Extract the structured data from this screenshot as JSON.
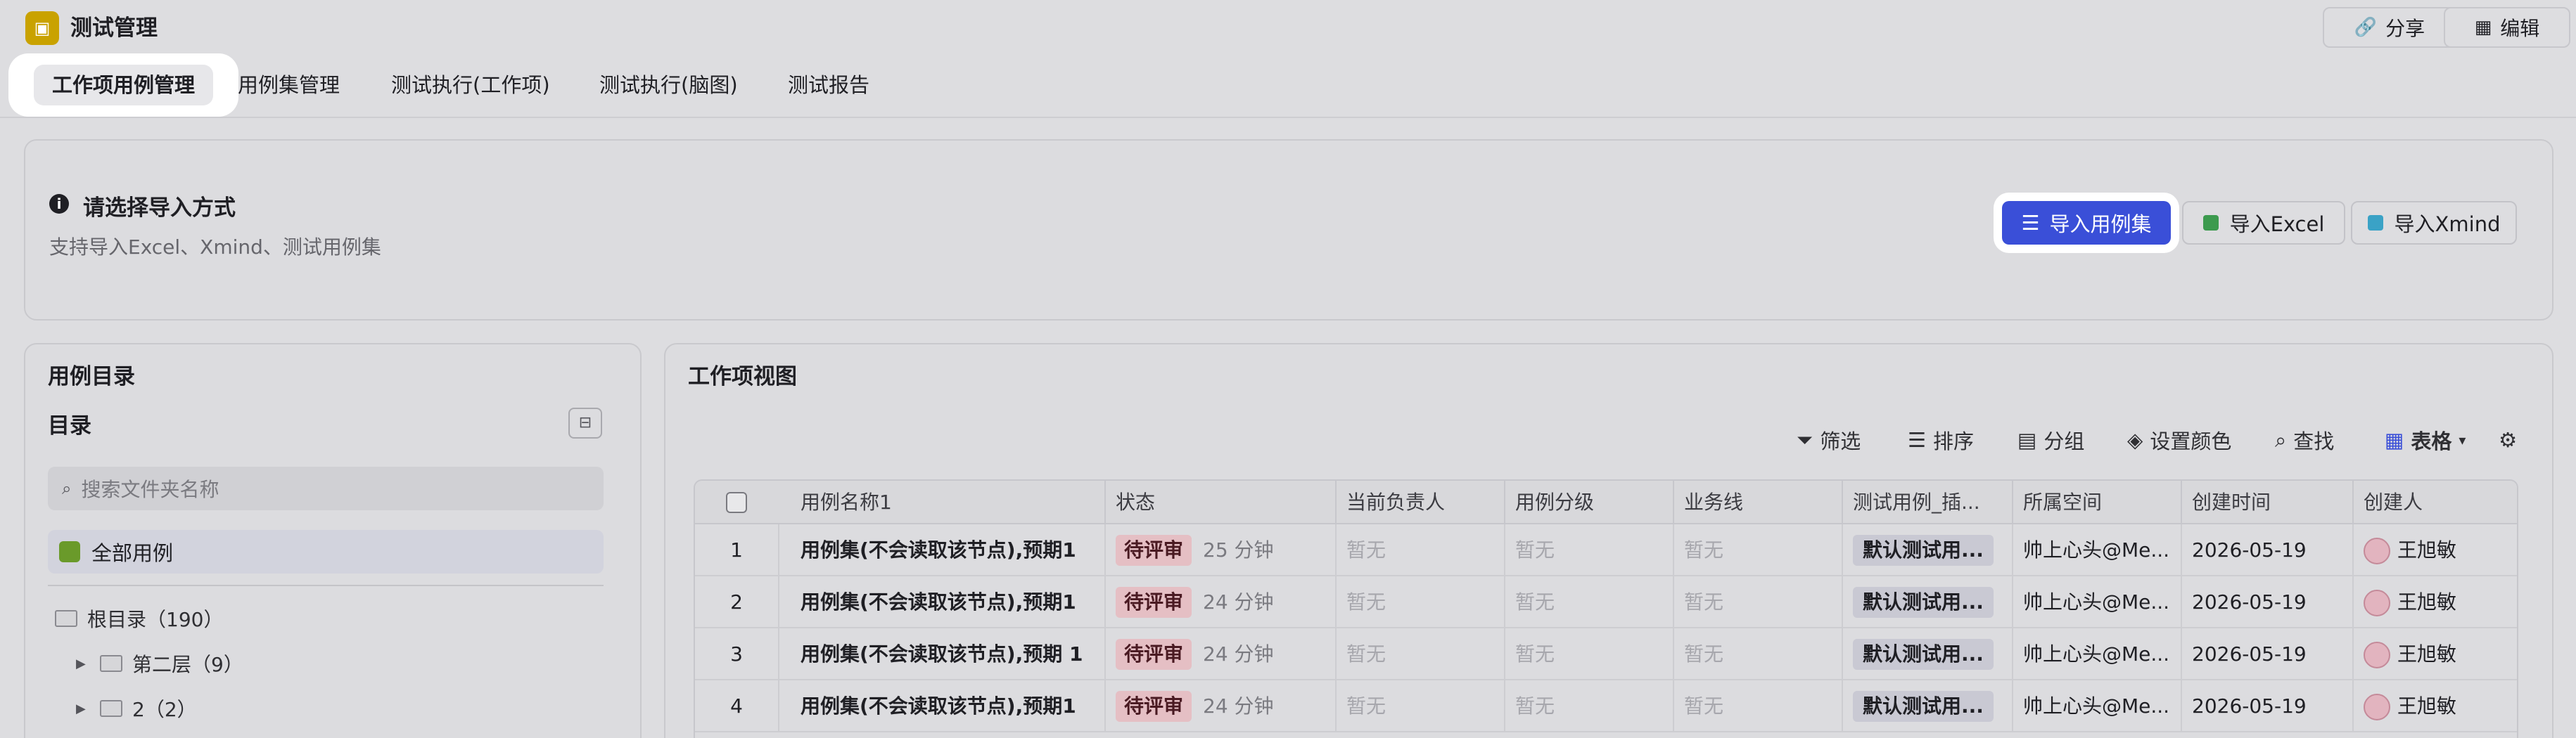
{
  "app": {
    "title": "测试管理",
    "icon": "app-logo-icon"
  },
  "top_actions": {
    "share": "分享",
    "edit": "编辑"
  },
  "tabs": [
    {
      "label": "工作项用例管理",
      "active": true
    },
    {
      "label": "用例集管理"
    },
    {
      "label": "测试执行(工作项)"
    },
    {
      "label": "测试执行(脑图)"
    },
    {
      "label": "测试报告"
    }
  ],
  "import": {
    "title": "请选择导入方式",
    "subtitle": "支持导入Excel、Xmind、测试用例集",
    "btn_case_set": "导入用例集",
    "btn_excel": "导入Excel",
    "btn_xmind": "导入Xmind"
  },
  "left_panel": {
    "title": "用例目录",
    "section": "目录",
    "search_placeholder": "搜索文件夹名称",
    "all_cases": "全部用例",
    "tree": [
      {
        "label": "根目录（190）",
        "level": 0
      },
      {
        "label": "第二层（9）",
        "level": 1
      },
      {
        "label": "2（2）",
        "level": 1
      }
    ]
  },
  "right_panel": {
    "title": "工作项视图",
    "toolbar": {
      "filter": "筛选",
      "sort": "排序",
      "group": "分组",
      "color": "设置颜色",
      "find": "查找",
      "view": "表格"
    },
    "columns": [
      "用例名称1",
      "状态",
      "当前负责人",
      "用例分级",
      "业务线",
      "测试用例_插...",
      "所属空间",
      "创建时间",
      "创建人"
    ],
    "rows": [
      {
        "no": "1",
        "name": "用例集(不会读取该节点),预期1",
        "status": "待评审",
        "duration": "25 分钟",
        "owner": "暂无",
        "level": "暂无",
        "line": "暂无",
        "plugin": "默认测试用...",
        "space": "帅上心头@Me...",
        "created": "2026-05-19",
        "creator": "王旭敏"
      },
      {
        "no": "2",
        "name": "用例集(不会读取该节点),预期1",
        "status": "待评审",
        "duration": "24 分钟",
        "owner": "暂无",
        "level": "暂无",
        "line": "暂无",
        "plugin": "默认测试用...",
        "space": "帅上心头@Me...",
        "created": "2026-05-19",
        "creator": "王旭敏"
      },
      {
        "no": "3",
        "name": "用例集(不会读取该节点),预期 1",
        "status": "待评审",
        "duration": "24 分钟",
        "owner": "暂无",
        "level": "暂无",
        "line": "暂无",
        "plugin": "默认测试用...",
        "space": "帅上心头@Me...",
        "created": "2026-05-19",
        "creator": "王旭敏"
      },
      {
        "no": "4",
        "name": "用例集(不会读取该节点),预期1",
        "status": "待评审",
        "duration": "24 分钟",
        "owner": "暂无",
        "level": "暂无",
        "line": "暂无",
        "plugin": "默认测试用...",
        "space": "帅上心头@Me...",
        "created": "2026-05-19",
        "creator": "王旭敏"
      }
    ]
  },
  "colors": {
    "primary": "#3a4fd8",
    "status_chip": "#e5bfc4",
    "app_icon": "#c9a200"
  }
}
